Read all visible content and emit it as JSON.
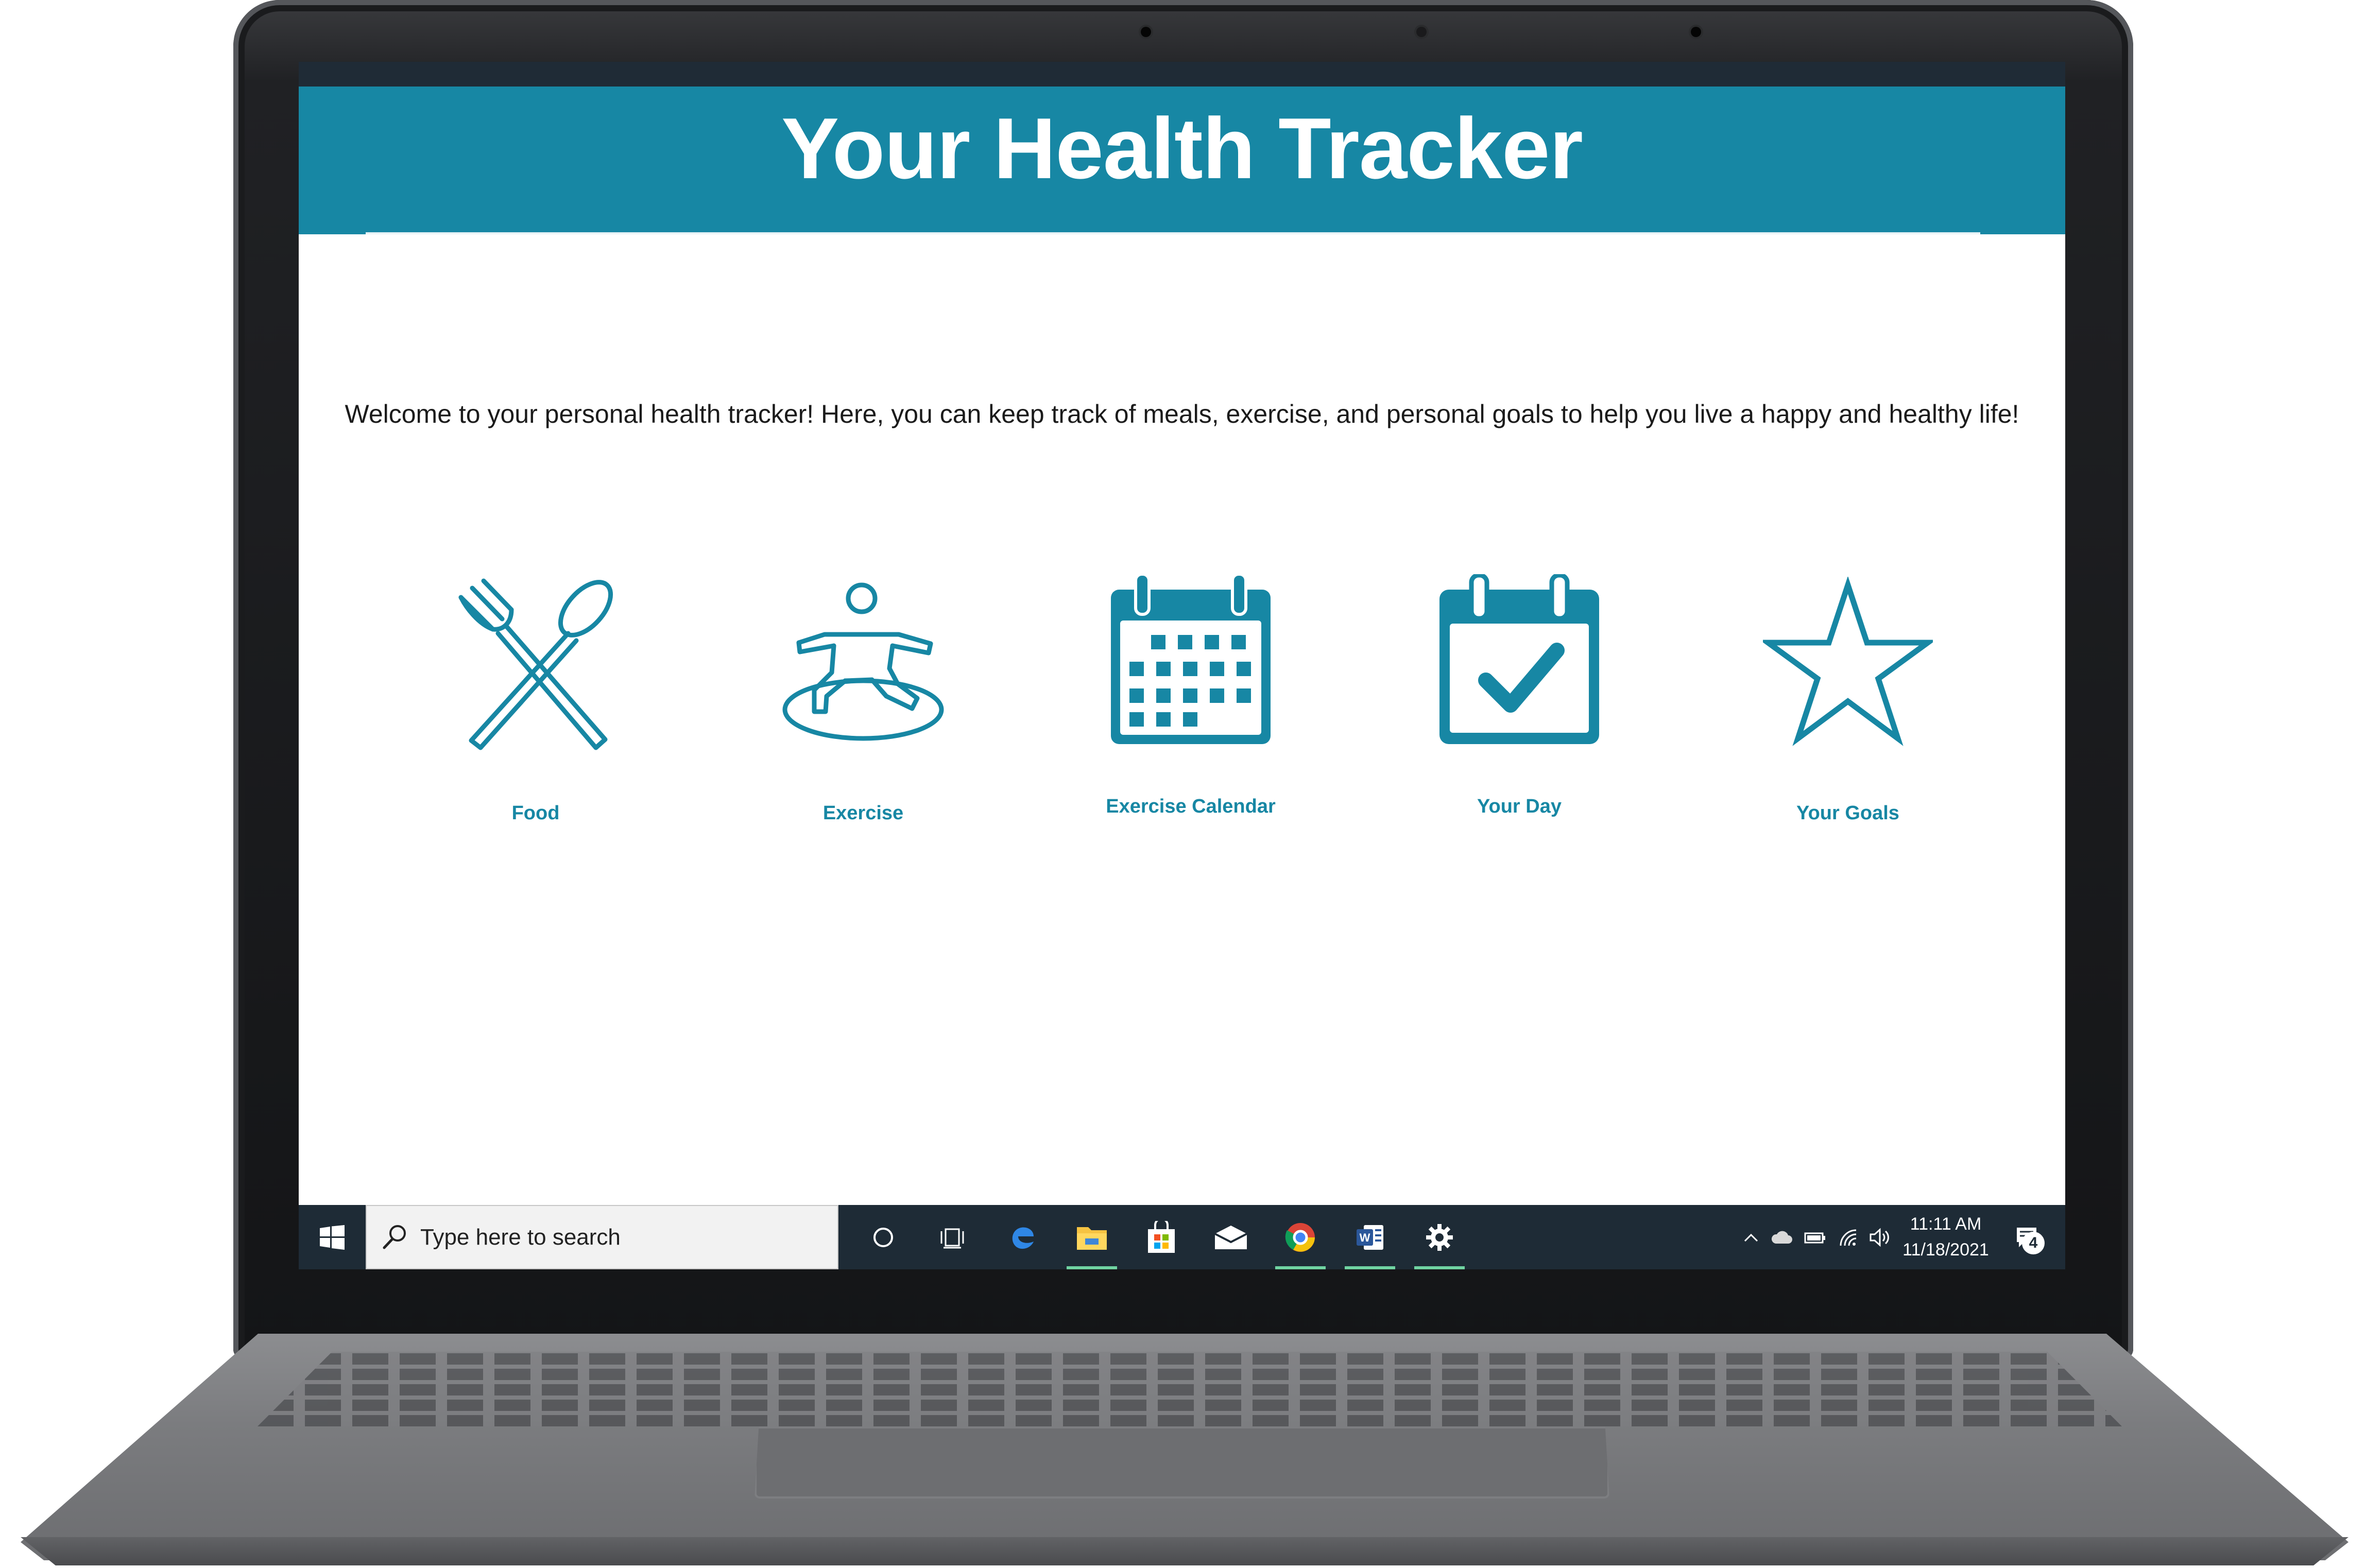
{
  "app": {
    "title": "Your Health Tracker",
    "welcome_text": "Welcome to your personal health tracker! Here, you can keep track of meals, exercise, and personal goals to help you live a happy and healthy life!",
    "accent_color": "#1787a4"
  },
  "tiles": [
    {
      "label": "Food",
      "icon": "fork-spoon-icon"
    },
    {
      "label": "Exercise",
      "icon": "yoga-pose-icon"
    },
    {
      "label": "Exercise Calendar",
      "icon": "calendar-icon"
    },
    {
      "label": "Your Day",
      "icon": "calendar-check-icon"
    },
    {
      "label": "Your Goals",
      "icon": "star-icon"
    }
  ],
  "taskbar": {
    "search_placeholder": "Type here to search",
    "apps": [
      {
        "name": "cortana",
        "icon": "circle-icon",
        "running": false
      },
      {
        "name": "task-view",
        "icon": "task-view-icon",
        "running": false
      },
      {
        "name": "edge",
        "icon": "edge-icon",
        "running": false
      },
      {
        "name": "file-explorer",
        "icon": "folder-icon",
        "running": true
      },
      {
        "name": "store",
        "icon": "store-icon",
        "running": false
      },
      {
        "name": "mail",
        "icon": "mail-icon",
        "running": false
      },
      {
        "name": "chrome",
        "icon": "chrome-icon",
        "running": true
      },
      {
        "name": "word",
        "icon": "word-icon",
        "running": true
      },
      {
        "name": "settings",
        "icon": "gear-icon",
        "running": true
      }
    ],
    "time": "11:11 AM",
    "date": "11/18/2021",
    "notification_count": "4"
  }
}
